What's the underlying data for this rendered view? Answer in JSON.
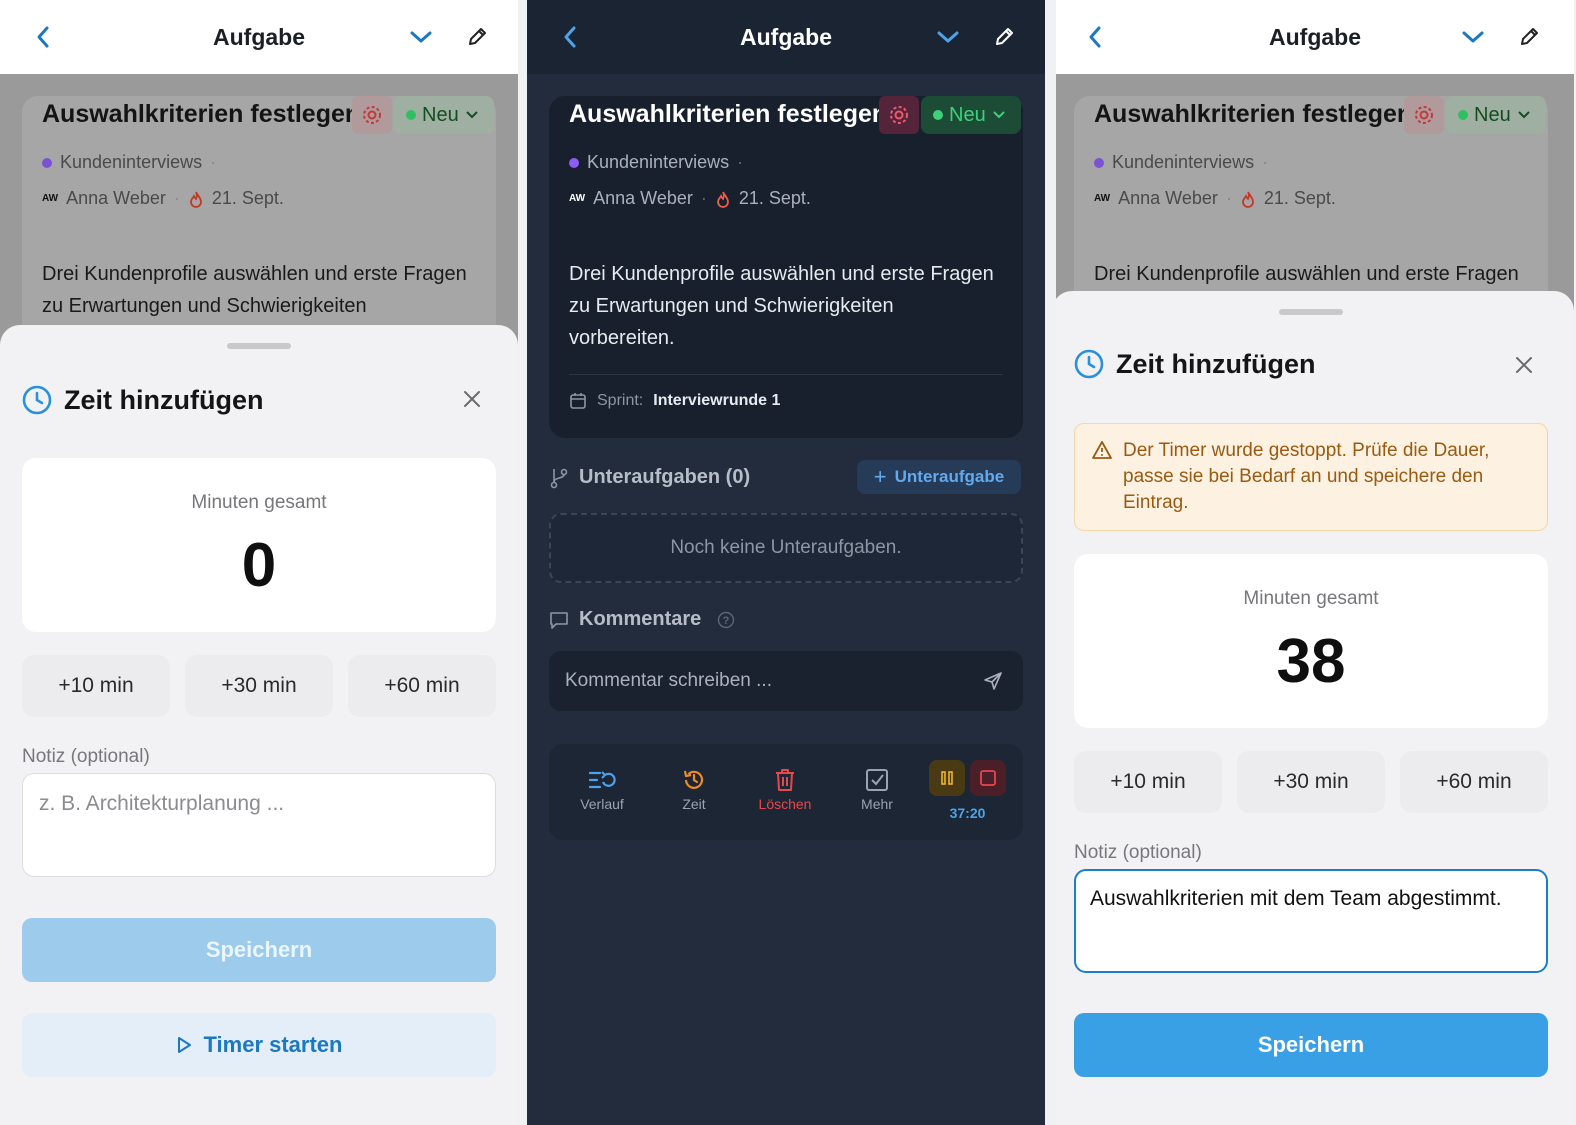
{
  "header": {
    "title": "Aufgabe"
  },
  "task": {
    "title": "Auswahlkriterien festlegen",
    "status": "Neu",
    "project": "Kundeninterviews",
    "assignee_initials": "AW",
    "assignee": "Anna Weber",
    "due": "21. Sept.",
    "description_line1": "Drei Kundenprofile auswählen und erste Fragen",
    "description_line2": "zu Erwartungen und Schwierigkeiten",
    "description_line3": "vorbereiten.",
    "sprint_label": "Sprint:",
    "sprint_value": "Interviewrunde 1"
  },
  "sheet": {
    "title": "Zeit hinzufügen",
    "minutes_label": "Minuten gesamt",
    "quick": [
      "+10 min",
      "+30 min",
      "+60 min"
    ],
    "note_label": "Notiz (optional)",
    "note_placeholder": "z. B. Architekturplanung ...",
    "save": "Speichern",
    "timer_start": "Timer starten"
  },
  "screen1": {
    "minutes": "0"
  },
  "screen3": {
    "minutes": "38",
    "warning_line1": "Der Timer wurde gestoppt. Prüfe die Dauer,",
    "warning_line2": "passe sie bei Bedarf an und speichere den",
    "warning_line3": "Eintrag.",
    "note_value": "Auswahlkriterien mit dem Team abgestimmt."
  },
  "screen2": {
    "subtasks_title": "Unteraufgaben (0)",
    "add_subtask": "Unteraufgabe",
    "no_subtasks": "Noch keine Unteraufgaben.",
    "comments_title": "Kommentare",
    "comment_placeholder": "Kommentar schreiben ...",
    "toolbar": {
      "history": "Verlauf",
      "time": "Zeit",
      "delete": "Löschen",
      "more": "Mehr",
      "timer": "37:20"
    }
  },
  "colors": {
    "accent_blue": "#1c78c0",
    "save_disabled": "#9ccbec",
    "save_enabled": "#3aa0e6",
    "status_green": "#2fbf62",
    "project_purple": "#8b5cf6",
    "danger_red": "#e5484d",
    "timer_orange": "#f08a24",
    "warning_bg": "#fdf2e1"
  },
  "icons": [
    "chevron-left-icon",
    "chevron-down-icon",
    "pencil-icon",
    "gear-icon",
    "flame-icon",
    "clock-icon",
    "close-icon",
    "play-icon",
    "warning-icon",
    "calendar-icon",
    "branch-icon",
    "plus-icon",
    "comment-icon",
    "help-icon",
    "send-icon",
    "history-icon",
    "trash-icon",
    "checkbox-icon",
    "pause-icon",
    "stop-icon"
  ]
}
